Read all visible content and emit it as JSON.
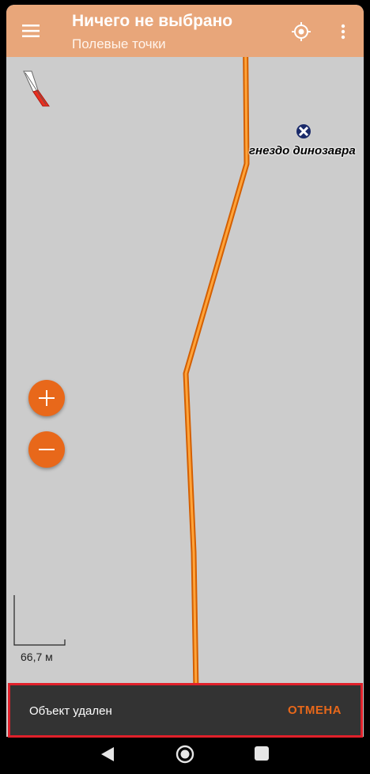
{
  "appbar": {
    "title": "Ничего не выбрано",
    "subtitle": "Полевые точки",
    "color": "#e8a67a",
    "icons": [
      "hamburger-menu-icon",
      "gps-locate-icon",
      "more-vertical-icon"
    ]
  },
  "map": {
    "background": "#cccccc",
    "track_color": "#ff8c1a",
    "poi": {
      "label": "гнездо динозавра",
      "icon": "cross-marker-icon"
    },
    "zoom": {
      "in_icon": "plus-icon",
      "out_icon": "minus-icon",
      "color": "#e8681a"
    },
    "scale": {
      "label": "66,7 м"
    },
    "compass_icon": "compass-needle-icon"
  },
  "snackbar": {
    "message": "Объект удален",
    "action": "ОТМЕНА",
    "action_color": "#e8681a",
    "highlight_color": "#e0202a"
  },
  "navbar": {
    "icons": [
      "back-icon",
      "home-icon",
      "recents-icon"
    ]
  }
}
